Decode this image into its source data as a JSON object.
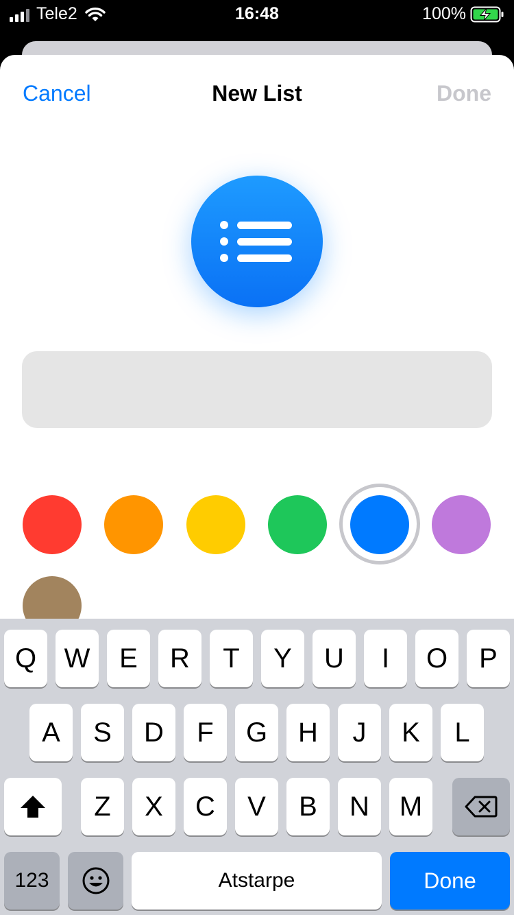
{
  "status_bar": {
    "carrier": "Tele2",
    "time": "16:48",
    "battery": "100%"
  },
  "nav": {
    "cancel": "Cancel",
    "title": "New List",
    "done": "Done"
  },
  "list_icon": "list-bullet-icon",
  "name_field": {
    "value": "",
    "placeholder": ""
  },
  "colors": [
    {
      "name": "red",
      "hex": "#ff3b30"
    },
    {
      "name": "orange",
      "hex": "#ff9500"
    },
    {
      "name": "yellow",
      "hex": "#ffcc00"
    },
    {
      "name": "green",
      "hex": "#1ec75a"
    },
    {
      "name": "blue",
      "hex": "#007aff",
      "selected": true
    },
    {
      "name": "purple",
      "hex": "#bf79dc"
    },
    {
      "name": "brown",
      "hex": "#a2845e"
    }
  ],
  "keyboard": {
    "row1": [
      "Q",
      "W",
      "E",
      "R",
      "T",
      "Y",
      "U",
      "I",
      "O",
      "P"
    ],
    "row2": [
      "A",
      "S",
      "D",
      "F",
      "G",
      "H",
      "J",
      "K",
      "L"
    ],
    "row3": [
      "Z",
      "X",
      "C",
      "V",
      "B",
      "N",
      "M"
    ],
    "numbers_key": "123",
    "space_key": "Atstarpe",
    "return_key": "Done"
  }
}
